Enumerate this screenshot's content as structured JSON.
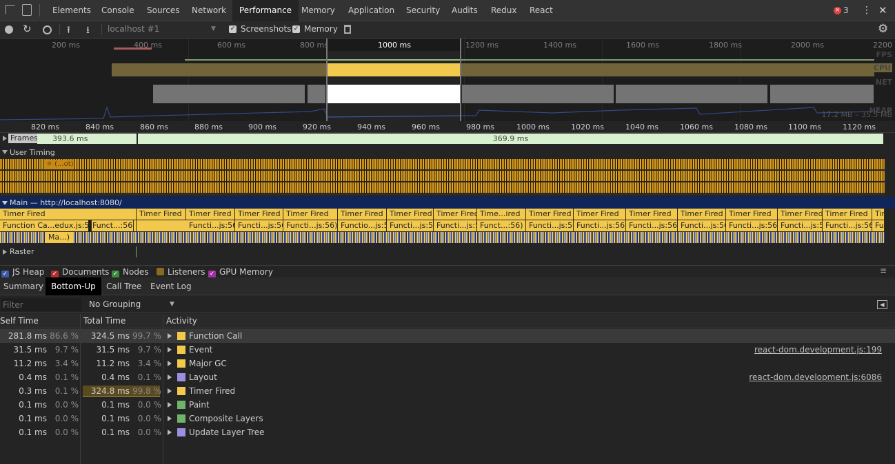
{
  "tabs": [
    "Elements",
    "Console",
    "Sources",
    "Network",
    "Performance",
    "Memory",
    "Application",
    "Security",
    "Audits",
    "Redux",
    "React"
  ],
  "active_tab": "Performance",
  "error_count": "3",
  "toolbar": {
    "target": "localhost #1",
    "screenshots_label": "Screenshots",
    "memory_label": "Memory"
  },
  "overview": {
    "ticks": [
      "200 ms",
      "400 ms",
      "600 ms",
      "800 ms",
      "1000 ms",
      "1200 ms",
      "1400 ms",
      "1600 ms",
      "1800 ms",
      "2000 ms",
      "2200"
    ],
    "fps_label": "FPS",
    "cpu_label": "CPU",
    "net_label": "NET",
    "heap_label": "HEAP",
    "heap_range": "17.2 MB – 35.5 MB"
  },
  "ruler_ticks": [
    "820 ms",
    "840 ms",
    "860 ms",
    "880 ms",
    "900 ms",
    "920 ms",
    "940 ms",
    "960 ms",
    "980 ms",
    "1000 ms",
    "1020 ms",
    "1040 ms",
    "1060 ms",
    "1080 ms",
    "1100 ms",
    "1120 ms"
  ],
  "frames": {
    "label": "Frames",
    "frame1": "393.6 ms",
    "frame2": "369.9 ms"
  },
  "user_timing_label": "User Timing",
  "user_timing_entry": "⚛ (...ot)",
  "main": {
    "label": "Main — http://localhost:8080/",
    "timer_row": [
      "Timer Fired",
      "Timer Fired",
      "Timer Fired",
      "Timer Fired",
      "Timer Fired",
      "Timer Fired",
      "Timer Fired",
      "Timer Fired",
      "Time...ired",
      "Timer Fired",
      "Timer Fired",
      "Timer Fired",
      "Timer Fired",
      "Timer Fired",
      "Timer Fired",
      "Timer Fired",
      "Timer Fired"
    ],
    "func_row": [
      "Function Ca...edux.js:56)",
      "Funct...:56)",
      "Functi...js:56)",
      "Functi...js:56)",
      "Functi...js:56)",
      "Functio...js:56)",
      "Functi...js:56)",
      "Functi...js:56)",
      "Funct...:56)",
      "Functi...js:56)",
      "Functi...js:56)",
      "Functi...js:56)",
      "Functi...js:56)",
      "Functi...js:56)",
      "Functi...js:56)",
      "Functi...js:56)",
      "Functi...js:56)"
    ],
    "ma_entry": "Ma...)"
  },
  "raster_label": "Raster",
  "legend": {
    "js_heap": "JS Heap",
    "documents": "Documents",
    "nodes": "Nodes",
    "listeners": "Listeners",
    "gpu_memory": "GPU Memory"
  },
  "subtabs": [
    "Summary",
    "Bottom-Up",
    "Call Tree",
    "Event Log"
  ],
  "active_subtab": "Bottom-Up",
  "filter_placeholder": "Filter",
  "grouping": "No Grouping",
  "columns": {
    "self_time": "Self Time",
    "total_time": "Total Time",
    "activity": "Activity"
  },
  "rows": [
    {
      "self": "281.8 ms",
      "self_pct": "86.6 %",
      "total": "324.5 ms",
      "total_pct": "99.7 %",
      "activity": "Function Call",
      "color": "#f2c94c",
      "link": ""
    },
    {
      "self": "31.5 ms",
      "self_pct": "9.7 %",
      "total": "31.5 ms",
      "total_pct": "9.7 %",
      "activity": "Event",
      "color": "#f2c94c",
      "link": "react-dom.development.js:199"
    },
    {
      "self": "11.2 ms",
      "self_pct": "3.4 %",
      "total": "11.2 ms",
      "total_pct": "3.4 %",
      "activity": "Major GC",
      "color": "#f2c94c",
      "link": ""
    },
    {
      "self": "0.4 ms",
      "self_pct": "0.1 %",
      "total": "0.4 ms",
      "total_pct": "0.1 %",
      "activity": "Layout",
      "color": "#9d8fe0",
      "link": "react-dom.development.js:6086"
    },
    {
      "self": "0.3 ms",
      "self_pct": "0.1 %",
      "total": "324.8 ms",
      "total_pct": "99.8 %",
      "activity": "Timer Fired",
      "color": "#f2c94c",
      "link": ""
    },
    {
      "self": "0.1 ms",
      "self_pct": "0.0 %",
      "total": "0.1 ms",
      "total_pct": "0.0 %",
      "activity": "Paint",
      "color": "#71b36b",
      "link": ""
    },
    {
      "self": "0.1 ms",
      "self_pct": "0.0 %",
      "total": "0.1 ms",
      "total_pct": "0.0 %",
      "activity": "Composite Layers",
      "color": "#71b36b",
      "link": ""
    },
    {
      "self": "0.1 ms",
      "self_pct": "0.0 %",
      "total": "0.1 ms",
      "total_pct": "0.0 %",
      "activity": "Update Layer Tree",
      "color": "#9d8fe0",
      "link": ""
    }
  ]
}
